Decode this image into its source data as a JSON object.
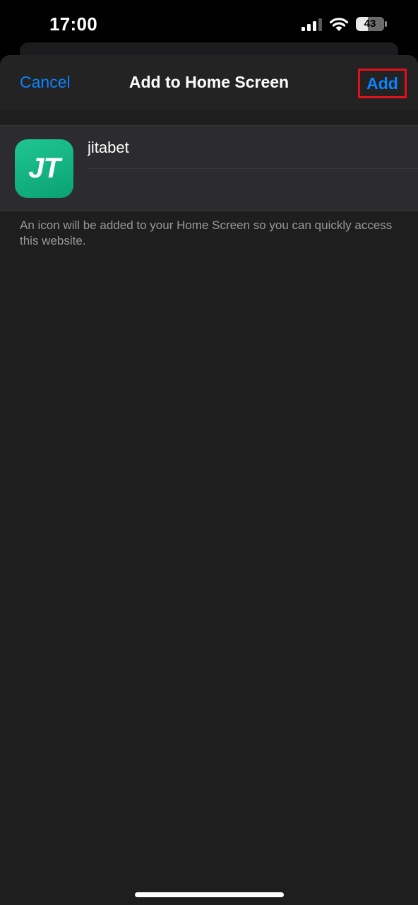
{
  "status_bar": {
    "time": "17:00",
    "signal_bars_active": 3,
    "signal_bars_total": 4,
    "wifi_icon": "wifi-icon",
    "battery_level": "43",
    "battery_fraction": 0.43
  },
  "nav": {
    "cancel_label": "Cancel",
    "title": "Add to Home Screen",
    "add_label": "Add"
  },
  "app_entry": {
    "icon_letters": "JT",
    "name_value": "jitabet"
  },
  "footer": {
    "note": "An icon will be added to your Home Screen so you can quickly access this website."
  },
  "colors": {
    "accent": "#0a84ff",
    "highlight_box": "#e0111b",
    "icon_green": "#12b680",
    "background": "#1e1e1e"
  }
}
